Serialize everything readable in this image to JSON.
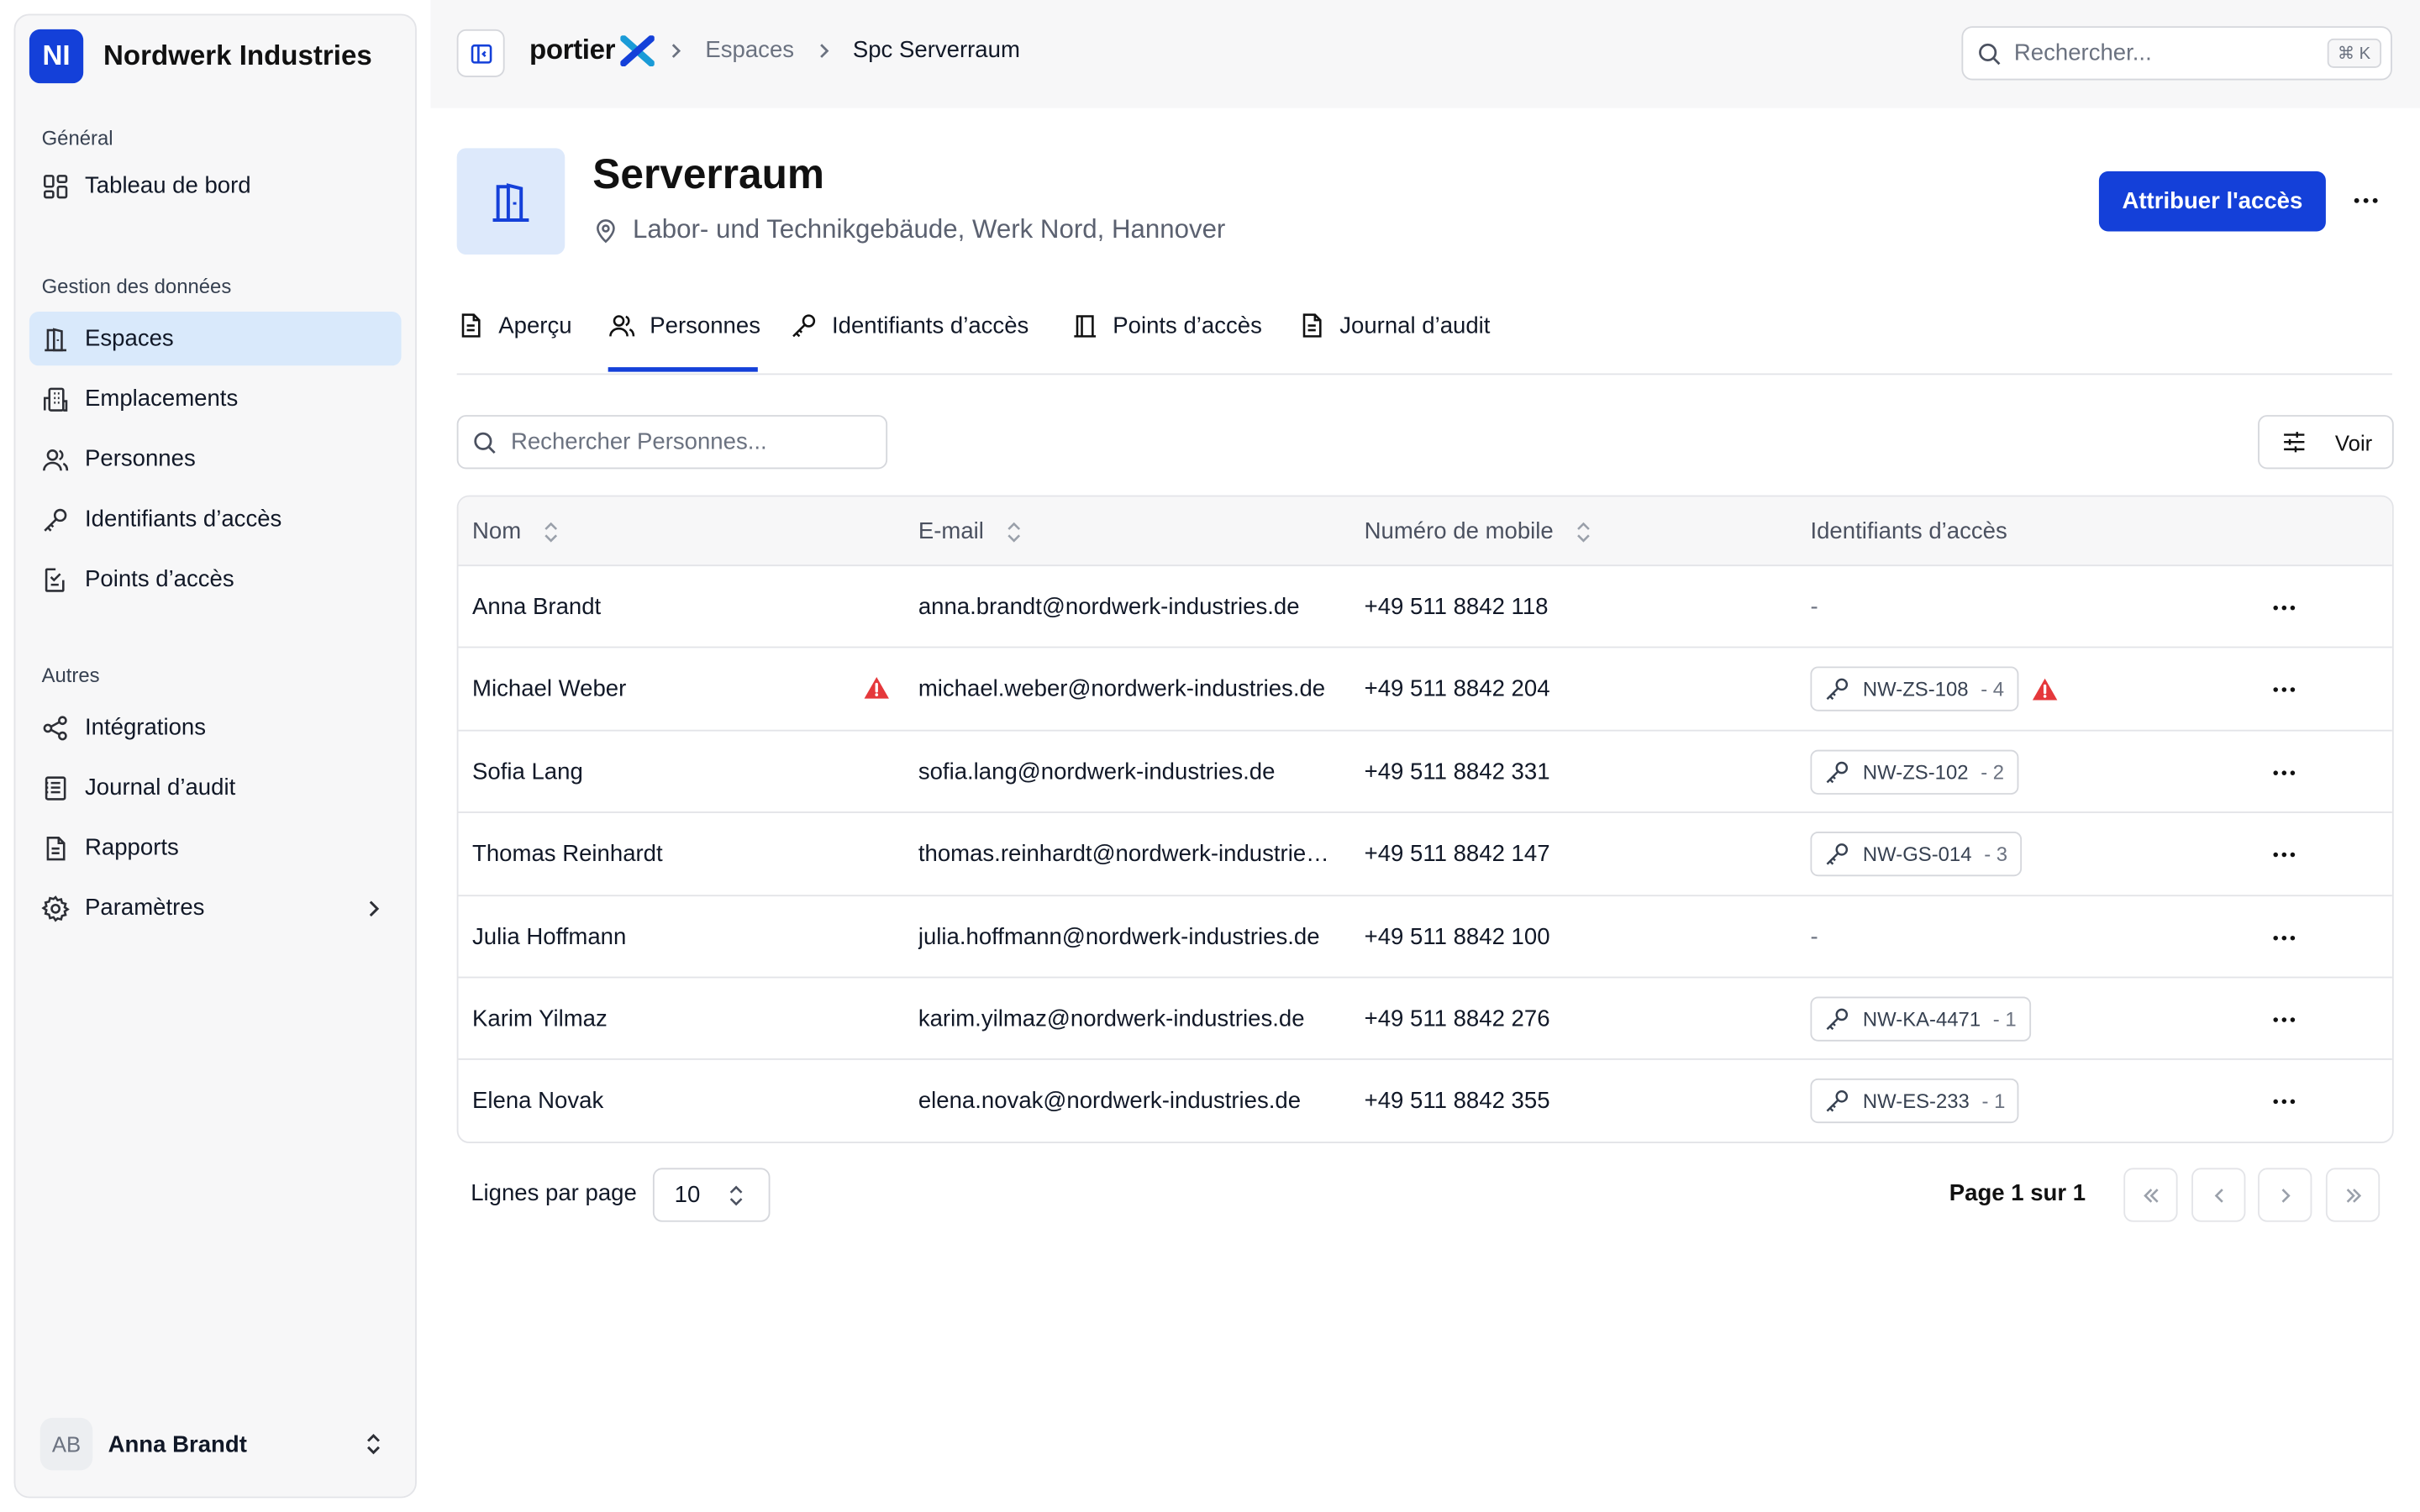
{
  "org": {
    "initials": "NI",
    "name": "Nordwerk Industries"
  },
  "sidebar": {
    "sections": [
      {
        "heading": "Général",
        "items": [
          {
            "label": "Tableau de bord",
            "icon": "dashboard-icon"
          }
        ]
      },
      {
        "heading": "Gestion des données",
        "items": [
          {
            "label": "Espaces",
            "icon": "door-icon",
            "active": true
          },
          {
            "label": "Emplacements",
            "icon": "building-icon"
          },
          {
            "label": "Personnes",
            "icon": "users-icon"
          },
          {
            "label": "Identifiants d’accès",
            "icon": "key-icon"
          },
          {
            "label": "Points d’accès",
            "icon": "access-point-icon"
          }
        ]
      },
      {
        "heading": "Autres",
        "items": [
          {
            "label": "Intégrations",
            "icon": "share-icon"
          },
          {
            "label": "Journal d’audit",
            "icon": "log-icon"
          },
          {
            "label": "Rapports",
            "icon": "report-icon"
          },
          {
            "label": "Paramètres",
            "icon": "gear-icon"
          }
        ]
      }
    ],
    "user": {
      "initials": "AB",
      "name": "Anna Brandt"
    }
  },
  "topbar": {
    "brand": "portier",
    "breadcrumb": [
      "Espaces",
      "Spc Serverraum"
    ],
    "search_placeholder": "Rechercher...",
    "shortcut": "⌘ K"
  },
  "space": {
    "title": "Serverraum",
    "location": "Labor- und Technikgebäude, Werk Nord, Hannover",
    "primary_action": "Attribuer l'accès"
  },
  "tabs": [
    {
      "label": "Aperçu",
      "icon": "document-icon"
    },
    {
      "label": "Personnes",
      "icon": "users-icon",
      "active": true
    },
    {
      "label": "Identifiants d’accès",
      "icon": "key-icon"
    },
    {
      "label": "Points d’accès",
      "icon": "access-point-icon"
    },
    {
      "label": "Journal d’audit",
      "icon": "document-icon"
    }
  ],
  "table": {
    "search_placeholder": "Rechercher Personnes...",
    "view_label": "Voir",
    "columns": [
      "Nom",
      "E-mail",
      "Numéro de mobile",
      "Identifiants d’accès"
    ],
    "rows": [
      {
        "name": "Anna Brandt",
        "email": "anna.brandt@nordwerk-industries.de",
        "phone": "+49 511 8842 118",
        "credential": "-",
        "credential_count": ""
      },
      {
        "name": "Michael Weber",
        "email": "michael.weber@nordwerk-industries.de",
        "phone": "+49 511 8842 204",
        "credential": "NW-ZS-108",
        "credential_count": "- 4",
        "warning": true
      },
      {
        "name": "Sofia Lang",
        "email": "sofia.lang@nordwerk-industries.de",
        "phone": "+49 511 8842 331",
        "credential": "NW-ZS-102",
        "credential_count": "- 2"
      },
      {
        "name": "Thomas Reinhardt",
        "email": "thomas.reinhardt@nordwerk-industries.de",
        "phone": "+49 511 8842 147",
        "credential": "NW-GS-014",
        "credential_count": "- 3"
      },
      {
        "name": "Julia Hoffmann",
        "email": "julia.hoffmann@nordwerk-industries.de",
        "phone": "+49 511 8842 100",
        "credential": "-",
        "credential_count": ""
      },
      {
        "name": "Karim Yilmaz",
        "email": "karim.yilmaz@nordwerk-industries.de",
        "phone": "+49 511 8842 276",
        "credential": "NW-KA-4471",
        "credential_count": "- 1"
      },
      {
        "name": "Elena Novak",
        "email": "elena.novak@nordwerk-industries.de",
        "phone": "+49 511 8842 355",
        "credential": "NW-ES-233",
        "credential_count": "- 1"
      }
    ]
  },
  "pagination": {
    "rows_label": "Lignes par page",
    "rows_value": "10",
    "page_label": "Page 1 sur 1"
  },
  "colors": {
    "accent": "#1440d9",
    "active_nav": "#d9e9fb",
    "warning": "#e5383b"
  }
}
